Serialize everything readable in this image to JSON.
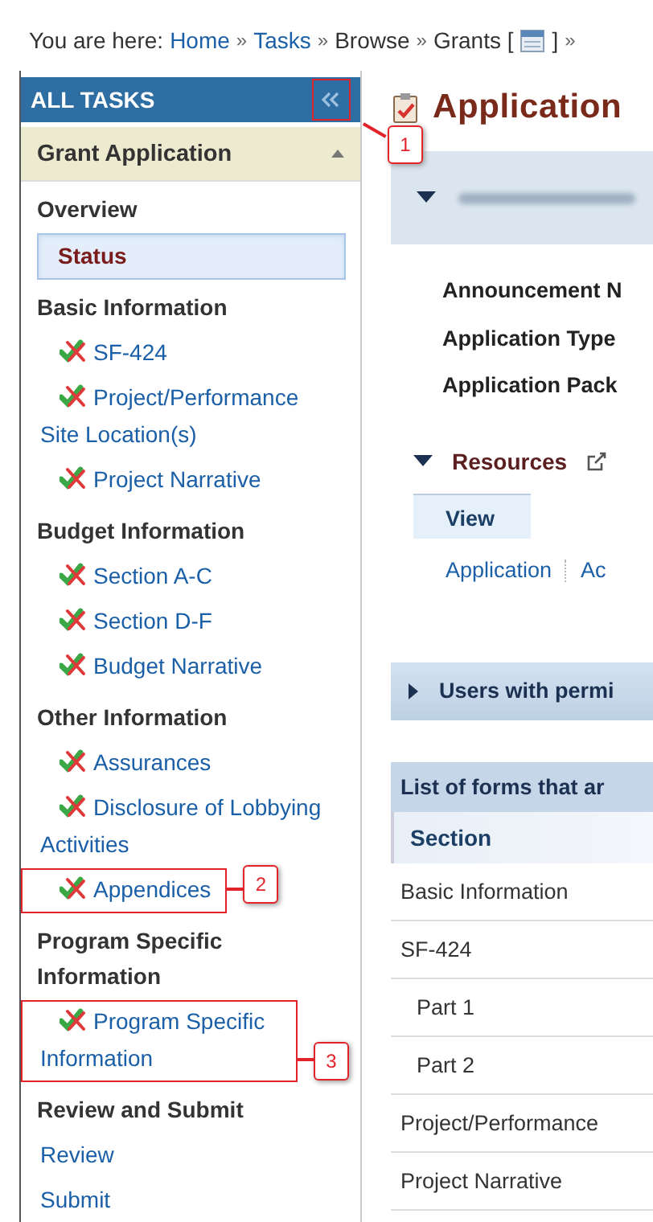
{
  "breadcrumb": {
    "label": "You are here:",
    "items": [
      {
        "kind": "link",
        "text": "Home"
      },
      {
        "kind": "separator",
        "text": "»"
      },
      {
        "kind": "link",
        "text": "Tasks"
      },
      {
        "kind": "separator",
        "text": "»"
      },
      {
        "kind": "text",
        "text": "Browse"
      },
      {
        "kind": "separator",
        "text": "»"
      },
      {
        "kind": "text",
        "text": "Grants ["
      },
      {
        "kind": "icon"
      },
      {
        "kind": "text",
        "text": "]"
      },
      {
        "kind": "separator",
        "text": "»"
      }
    ]
  },
  "sidebar": {
    "title": "ALL TASKS",
    "collapse_callout": "1",
    "section": {
      "title": "Grant Application",
      "expanded": true
    },
    "groups": [
      {
        "heading": "Overview",
        "items": [
          {
            "label": "Status",
            "kind": "plain",
            "selected": true
          }
        ]
      },
      {
        "heading": "Basic Information",
        "items": [
          {
            "label": "SF-424",
            "kind": "form",
            "selected": false
          },
          {
            "label": "Project/Performance Site Location(s)",
            "kind": "form",
            "selected": false
          },
          {
            "label": "Project Narrative",
            "kind": "form",
            "selected": false
          }
        ]
      },
      {
        "heading": "Budget Information",
        "items": [
          {
            "label": "Section A-C",
            "kind": "form",
            "selected": false
          },
          {
            "label": "Section D-F",
            "kind": "form",
            "selected": false
          },
          {
            "label": "Budget Narrative",
            "kind": "form",
            "selected": false
          }
        ]
      },
      {
        "heading": "Other Information",
        "items": [
          {
            "label": "Assurances",
            "kind": "form",
            "selected": false
          },
          {
            "label": "Disclosure of Lobbying Activities",
            "kind": "form",
            "selected": false
          },
          {
            "label": "Appendices",
            "kind": "form",
            "selected": false,
            "callout": "2"
          }
        ]
      },
      {
        "heading": "Program Specific Information",
        "items": [
          {
            "label": "Program Specific Information",
            "kind": "form",
            "selected": false,
            "callout": "3"
          }
        ]
      },
      {
        "heading": "Review and Submit",
        "items": [
          {
            "label": "Review",
            "kind": "plain",
            "selected": false
          },
          {
            "label": "Submit",
            "kind": "plain",
            "selected": false
          }
        ]
      }
    ]
  },
  "main": {
    "title": "Application",
    "summary": {
      "expanded": true
    },
    "fields": [
      "Announcement N",
      "Application Type",
      "Application Pack"
    ],
    "resources": {
      "title": "Resources",
      "expanded": true,
      "tabs": [
        {
          "label": "View",
          "selected": true
        }
      ],
      "links": [
        "Application",
        "Ac"
      ]
    },
    "users_panel": {
      "title": "Users with permi",
      "expanded": false
    },
    "forms_table": {
      "caption": "List of forms that ar",
      "columns": [
        "Section"
      ],
      "rows": [
        {
          "section": "Basic Information"
        },
        {
          "section": "SF-424",
          "children": [
            {
              "section": "Part 1"
            },
            {
              "section": "Part 2"
            }
          ]
        },
        {
          "section": "Project/Performance"
        },
        {
          "section": "Project Narrative"
        }
      ]
    }
  }
}
